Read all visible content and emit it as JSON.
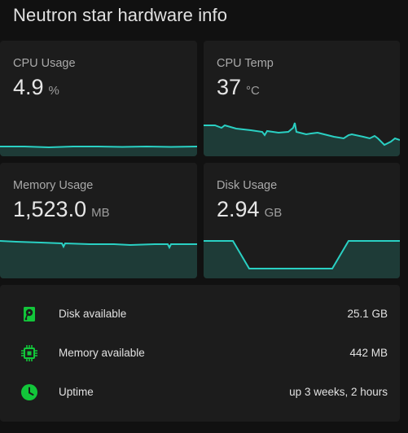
{
  "page": {
    "title": "Neutron star hardware info"
  },
  "cards": {
    "cpu_usage": {
      "label": "CPU Usage",
      "value": "4.9",
      "unit": "%"
    },
    "cpu_temp": {
      "label": "CPU Temp",
      "value": "37",
      "unit": "°C"
    },
    "memory_usage": {
      "label": "Memory Usage",
      "value": "1,523.0",
      "unit": "MB"
    },
    "disk_usage": {
      "label": "Disk Usage",
      "value": "2.94",
      "unit": "GB"
    }
  },
  "info": {
    "disk_available": {
      "label": "Disk available",
      "value": "25.1 GB",
      "icon": "harddisk-icon"
    },
    "memory_available": {
      "label": "Memory available",
      "value": "442 MB",
      "icon": "memory-chip-icon"
    },
    "uptime": {
      "label": "Uptime",
      "value": "up 3 weeks, 2 hours",
      "icon": "clock-icon"
    }
  },
  "colors": {
    "accent_line": "#2ad0c3",
    "graph_fill": "#1e3b37",
    "icon_green": "#12c63a",
    "card_bg": "#1c1c1c",
    "page_bg": "#111111"
  }
}
